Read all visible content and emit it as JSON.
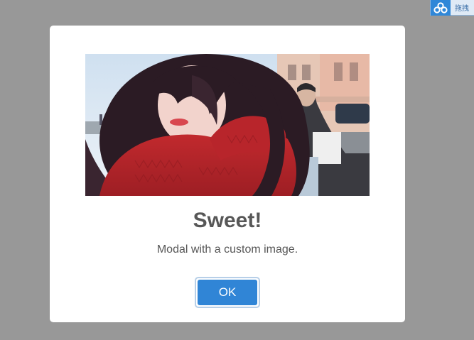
{
  "overlay": {
    "color": "#989898"
  },
  "corner_widget": {
    "icon": "cloud-share-icon",
    "label": "拖拽"
  },
  "modal": {
    "image": "custom-modal-image",
    "title": "Sweet!",
    "text": "Modal with a custom image.",
    "confirm_label": "OK",
    "confirm_color": "#3085d6"
  }
}
